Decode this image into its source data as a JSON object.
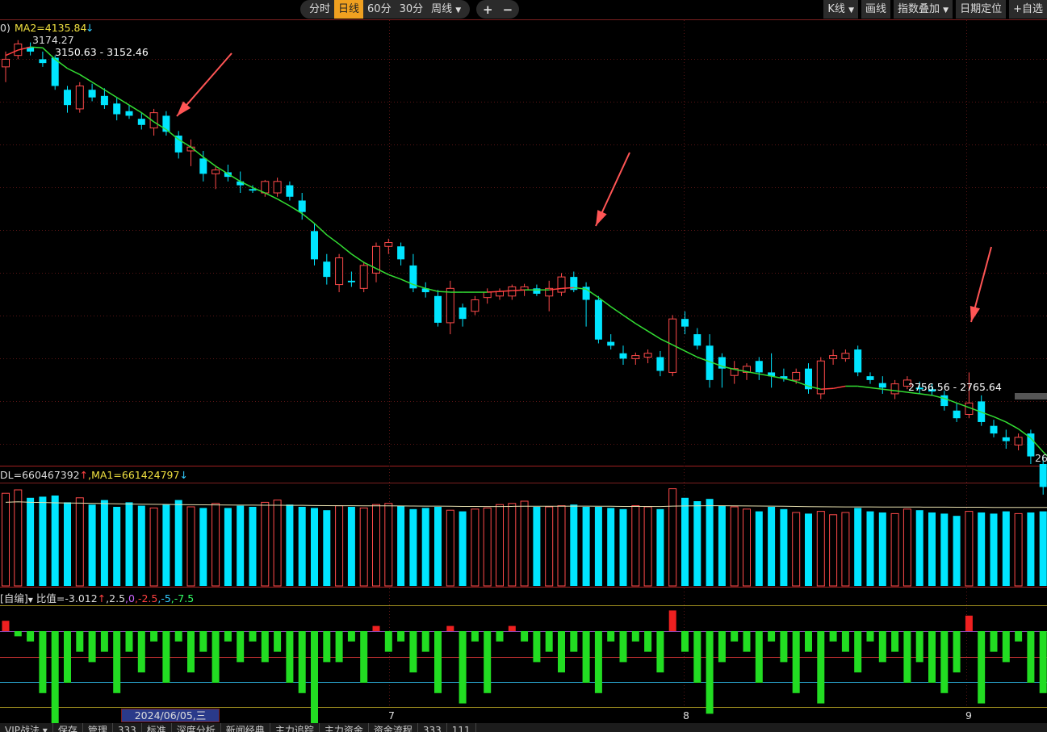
{
  "toolbar": {
    "timeframes": [
      "分时",
      "日线",
      "60分",
      "30分",
      "周线"
    ],
    "active_timeframe": "日线",
    "zoom_in": "+",
    "zoom_out": "−",
    "right": {
      "kline": "K线",
      "draw": "画线",
      "index_overlay": "指数叠加",
      "date_locate": "日期定位",
      "add_watch": "+自选"
    }
  },
  "main_panel": {
    "header_prefix": "0)",
    "ma2_label": "MA2=4135.84",
    "ma2_arrow": "↓",
    "price_high_label": "3174.27",
    "range_label_1": "3150.63 - 3152.46",
    "range_label_2": "2756.56 - 2765.64",
    "edge_label": "26"
  },
  "volume_panel": {
    "header": "DL=660467392",
    "vol_arrow": "↑",
    "ma1_label": ",MA1=661424797",
    "ma1_arrow": "↓"
  },
  "indicator_panel": {
    "prefix": "[自编]",
    "ratio_label": "比值=-3.012",
    "ratio_arrow": "↑",
    "levels": [
      ",2.5",
      ",0",
      ",-2.5",
      ",-5",
      ",-7.5"
    ]
  },
  "x_axis": {
    "selected_date": "2024/06/05,三",
    "month_labels": [
      "7",
      "8",
      "9"
    ]
  },
  "bottom_tabs": [
    "VIP战法 ▾",
    "保存",
    "管理",
    "333",
    "标准",
    "深度分析",
    "新闻经典",
    "主力追踪",
    "主力资金",
    "资金流程",
    "333",
    "111"
  ],
  "colors": {
    "up": "#ff4a4a",
    "down": "#00e5ff",
    "ma_green": "#33dd33",
    "ma_red": "#ff4040",
    "arrow": "#ff5555"
  },
  "chart_data": {
    "type": "candlestick",
    "price_range": [
      2620,
      3180
    ],
    "candles": [
      [
        3140,
        3160,
        3120,
        3150
      ],
      [
        3155,
        3175,
        3150,
        3170
      ],
      [
        3166,
        3172,
        3155,
        3160
      ],
      [
        3150,
        3160,
        3140,
        3145
      ],
      [
        3152,
        3155,
        3110,
        3115
      ],
      [
        3110,
        3115,
        3080,
        3090
      ],
      [
        3085,
        3120,
        3080,
        3115
      ],
      [
        3110,
        3118,
        3095,
        3100
      ],
      [
        3102,
        3112,
        3085,
        3090
      ],
      [
        3092,
        3100,
        3070,
        3078
      ],
      [
        3082,
        3090,
        3072,
        3076
      ],
      [
        3072,
        3080,
        3058,
        3064
      ],
      [
        3060,
        3085,
        3050,
        3080
      ],
      [
        3076,
        3082,
        3050,
        3055
      ],
      [
        3050,
        3056,
        3020,
        3028
      ],
      [
        3030,
        3045,
        3010,
        3035
      ],
      [
        3020,
        3030,
        2990,
        3000
      ],
      [
        3000,
        3010,
        2980,
        3005
      ],
      [
        3002,
        3012,
        2990,
        2996
      ],
      [
        2990,
        3003,
        2975,
        2985
      ],
      [
        2980,
        2985,
        2975,
        2978
      ],
      [
        2975,
        2992,
        2970,
        2990
      ],
      [
        2975,
        2995,
        2970,
        2990
      ],
      [
        2985,
        2990,
        2965,
        2970
      ],
      [
        2965,
        2975,
        2940,
        2950
      ],
      [
        2925,
        2935,
        2880,
        2888
      ],
      [
        2885,
        2895,
        2855,
        2865
      ],
      [
        2855,
        2895,
        2845,
        2890
      ],
      [
        2860,
        2872,
        2852,
        2858
      ],
      [
        2850,
        2885,
        2845,
        2880
      ],
      [
        2870,
        2910,
        2858,
        2905
      ],
      [
        2905,
        2915,
        2895,
        2910
      ],
      [
        2905,
        2910,
        2880,
        2888
      ],
      [
        2880,
        2895,
        2845,
        2850
      ],
      [
        2850,
        2858,
        2838,
        2845
      ],
      [
        2840,
        2848,
        2800,
        2805
      ],
      [
        2805,
        2860,
        2790,
        2850
      ],
      [
        2825,
        2830,
        2800,
        2810
      ],
      [
        2820,
        2840,
        2815,
        2835
      ],
      [
        2838,
        2850,
        2830,
        2845
      ],
      [
        2840,
        2850,
        2835,
        2846
      ],
      [
        2840,
        2855,
        2835,
        2852
      ],
      [
        2848,
        2856,
        2840,
        2852
      ],
      [
        2850,
        2855,
        2840,
        2843
      ],
      [
        2840,
        2860,
        2820,
        2850
      ],
      [
        2845,
        2870,
        2840,
        2865
      ],
      [
        2865,
        2872,
        2845,
        2848
      ],
      [
        2852,
        2858,
        2800,
        2835
      ],
      [
        2835,
        2840,
        2778,
        2783
      ],
      [
        2780,
        2790,
        2770,
        2775
      ],
      [
        2765,
        2775,
        2750,
        2758
      ],
      [
        2758,
        2766,
        2750,
        2762
      ],
      [
        2760,
        2770,
        2752,
        2765
      ],
      [
        2760,
        2768,
        2735,
        2742
      ],
      [
        2740,
        2815,
        2735,
        2810
      ],
      [
        2810,
        2820,
        2790,
        2800
      ],
      [
        2790,
        2798,
        2770,
        2775
      ],
      [
        2775,
        2790,
        2720,
        2730
      ],
      [
        2760,
        2765,
        2720,
        2745
      ],
      [
        2736,
        2755,
        2725,
        2745
      ],
      [
        2740,
        2752,
        2730,
        2748
      ],
      [
        2755,
        2760,
        2730,
        2740
      ],
      [
        2740,
        2765,
        2720,
        2735
      ],
      [
        2735,
        2745,
        2728,
        2732
      ],
      [
        2730,
        2745,
        2725,
        2740
      ],
      [
        2745,
        2752,
        2712,
        2718
      ],
      [
        2712,
        2760,
        2705,
        2755
      ],
      [
        2758,
        2770,
        2750,
        2762
      ],
      [
        2758,
        2770,
        2754,
        2765
      ],
      [
        2770,
        2775,
        2735,
        2740
      ],
      [
        2735,
        2740,
        2725,
        2730
      ],
      [
        2726,
        2735,
        2712,
        2720
      ],
      [
        2712,
        2730,
        2705,
        2725
      ],
      [
        2722,
        2735,
        2718,
        2730
      ],
      [
        2720,
        2728,
        2712,
        2718
      ],
      [
        2718,
        2725,
        2710,
        2715
      ],
      [
        2710,
        2716,
        2690,
        2696
      ],
      [
        2690,
        2700,
        2675,
        2680
      ],
      [
        2685,
        2740,
        2680,
        2700
      ],
      [
        2702,
        2710,
        2670,
        2675
      ],
      [
        2670,
        2678,
        2655,
        2660
      ],
      [
        2655,
        2665,
        2640,
        2650
      ],
      [
        2645,
        2660,
        2638,
        2655
      ],
      [
        2660,
        2665,
        2620,
        2630
      ],
      [
        2620,
        2630,
        2580,
        2590
      ],
      [
        2595,
        2620,
        2570,
        2610
      ]
    ],
    "ma_line": [
      3155,
      3162,
      3166,
      3165,
      3150,
      3138,
      3130,
      3120,
      3110,
      3100,
      3090,
      3080,
      3068,
      3058,
      3045,
      3035,
      3022,
      3010,
      3000,
      2990,
      2982,
      2975,
      2967,
      2958,
      2948,
      2935,
      2920,
      2908,
      2895,
      2884,
      2876,
      2868,
      2862,
      2855,
      2850,
      2846,
      2845,
      2845,
      2845,
      2845,
      2846,
      2847,
      2848,
      2848,
      2848,
      2850,
      2851,
      2849,
      2838,
      2826,
      2815,
      2804,
      2794,
      2784,
      2776,
      2768,
      2760,
      2754,
      2748,
      2744,
      2741,
      2738,
      2735,
      2732,
      2728,
      2722,
      2718,
      2719,
      2722,
      2722,
      2720,
      2718,
      2716,
      2714,
      2712,
      2710,
      2706,
      2700,
      2694,
      2688,
      2682,
      2675,
      2666,
      2654,
      2636,
      2620
    ],
    "volume": [
      820,
      850,
      780,
      790,
      800,
      740,
      780,
      720,
      760,
      700,
      740,
      710,
      690,
      720,
      760,
      700,
      690,
      730,
      690,
      710,
      700,
      740,
      760,
      720,
      700,
      690,
      670,
      710,
      700,
      690,
      720,
      730,
      710,
      680,
      690,
      700,
      670,
      660,
      680,
      690,
      720,
      730,
      750,
      700,
      700,
      710,
      720,
      700,
      700,
      690,
      680,
      710,
      700,
      680,
      860,
      780,
      750,
      770,
      710,
      700,
      680,
      660,
      700,
      680,
      650,
      640,
      660,
      630,
      650,
      690,
      660,
      650,
      640,
      680,
      670,
      650,
      640,
      620,
      660,
      650,
      640,
      660,
      640,
      650,
      660,
      640
    ],
    "vol_ma": [
      740,
      745,
      740,
      738,
      736,
      734,
      733,
      731,
      729,
      727,
      725,
      723,
      722,
      721,
      720,
      719,
      718,
      717,
      716,
      715,
      715,
      714,
      714,
      713,
      713,
      712,
      711,
      710,
      710,
      709,
      709,
      709,
      708,
      707,
      706,
      706,
      705,
      704,
      704,
      703,
      703,
      704,
      705,
      705,
      705,
      705,
      706,
      706,
      705,
      705,
      704,
      704,
      704,
      703,
      706,
      708,
      709,
      710,
      710,
      709,
      708,
      707,
      706,
      705,
      704,
      702,
      701,
      700,
      699,
      699,
      699,
      698,
      698,
      698,
      698,
      697,
      697,
      696,
      696,
      696,
      695,
      695,
      695,
      695,
      695,
      695
    ],
    "indicator": [
      1,
      -0.5,
      -1,
      -6,
      -10,
      -5,
      -2,
      -3,
      -2,
      -6,
      -2,
      -4,
      -1,
      -5,
      -1,
      -4,
      -2,
      -5,
      -1,
      -3,
      -1,
      -3,
      -2,
      -5,
      -6,
      -10,
      -3,
      -3,
      -1,
      -5,
      0.5,
      -2,
      -1,
      -4,
      -2,
      -6,
      0.5,
      -7,
      -1,
      -6,
      -1,
      0.5,
      -1,
      -3,
      -2,
      -4,
      -2,
      -5,
      -6,
      -1,
      -3,
      -1,
      -2,
      -4,
      2,
      -2,
      -5,
      -8,
      -3,
      -1,
      -2,
      -5,
      -1,
      -3,
      -6,
      -2,
      -7,
      -1,
      -2,
      -4,
      -1,
      -3,
      -2,
      -5,
      -3,
      -5,
      -6,
      -4,
      1.5,
      -7,
      -2,
      -3,
      -1,
      -5,
      -6,
      -2
    ]
  }
}
